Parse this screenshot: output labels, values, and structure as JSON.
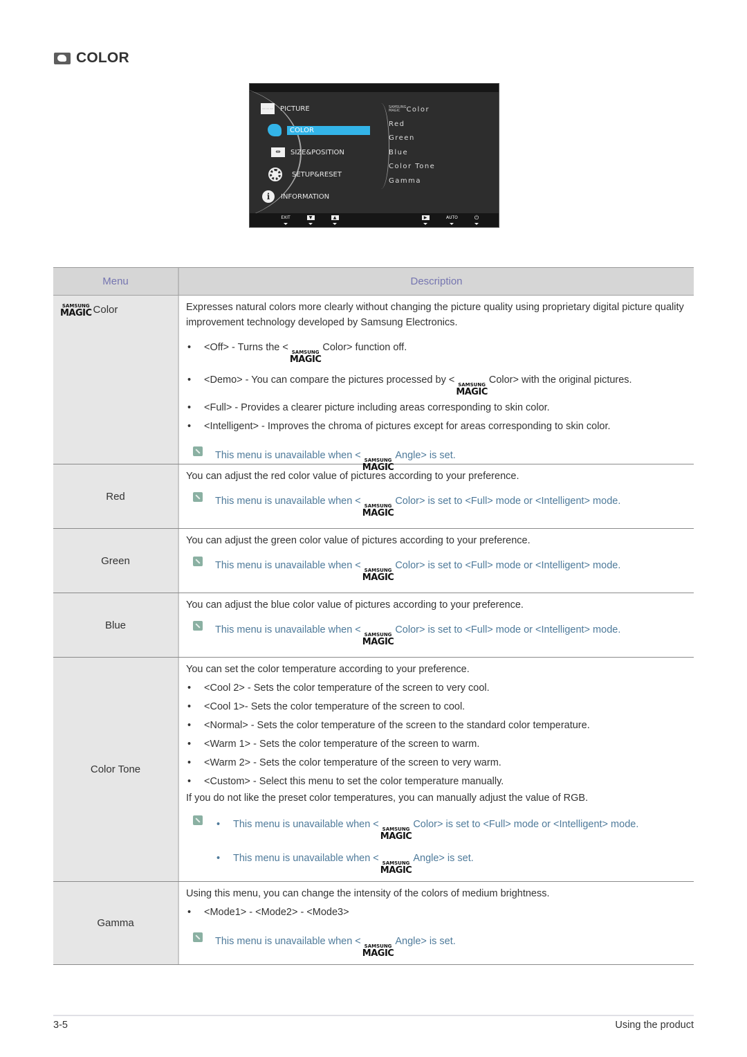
{
  "page": {
    "title": "COLOR",
    "title_icon": "palette-icon"
  },
  "osd": {
    "main_menu": [
      {
        "label": "PICTURE",
        "icon": "picture-icon"
      },
      {
        "label": "COLOR",
        "icon": "palette-icon",
        "selected": true
      },
      {
        "label": "SIZE&POSITION",
        "icon": "size-position-icon"
      },
      {
        "label": "SETUP&RESET",
        "icon": "gear-icon"
      },
      {
        "label": "INFORMATION",
        "icon": "info-icon"
      }
    ],
    "submenu": {
      "magic_top": "SAMSUNG",
      "magic_bottom": "MAGIC",
      "items": [
        "Color",
        "Red",
        "Green",
        "Blue",
        "Color Tone",
        "Gamma"
      ]
    },
    "buttons": {
      "exit": "EXIT",
      "down": "▼",
      "up": "▲",
      "enter": "▶",
      "auto": "AUTO",
      "power": "⏻"
    },
    "selected_color": "#33b4e8"
  },
  "magic": {
    "top": "SAMSUNG",
    "bottom": "MAGIC"
  },
  "table": {
    "headers": {
      "menu": "Menu",
      "description": "Description"
    },
    "header_color": "#7575b0",
    "note_color": "#4e7a9a",
    "rows": [
      {
        "menu": "Color",
        "intro": "Expresses natural colors more clearly without changing the picture quality using proprietary digital picture quality improvement technology developed by Samsung Electronics.",
        "bullets": [
          {
            "pre": "<Off> - Turns the <",
            "post": "Color> function off."
          },
          {
            "pre": "<Demo> - You can compare the pictures processed by <",
            "post": "Color> with the original pictures."
          },
          {
            "text": "<Full> - Provides a clearer picture including areas corresponding to skin color."
          },
          {
            "text": "<Intelligent> - Improves the chroma of pictures except for areas corresponding to skin color."
          }
        ],
        "note": {
          "pre": "This menu is unavailable when <",
          "post": "Angle> is set."
        }
      },
      {
        "menu": "Red",
        "intro": "You can adjust the red color value of pictures according to your preference.",
        "note": {
          "pre": "This menu is unavailable when <",
          "post": "Color> is set to <Full> mode or <Intelligent> mode."
        }
      },
      {
        "menu": "Green",
        "intro": "You can adjust the green color value of pictures according to your preference.",
        "note": {
          "pre": "This menu is unavailable when <",
          "post": "Color> is set to <Full> mode or <Intelligent> mode."
        }
      },
      {
        "menu": "Blue",
        "intro": "You can adjust the blue color value of pictures according to your preference.",
        "note": {
          "pre": "This menu is unavailable when <",
          "post": "Color> is set to <Full> mode or <Intelligent> mode."
        }
      },
      {
        "menu": "Color Tone",
        "intro": "You can set the color temperature according to your preference.",
        "bullets": [
          "<Cool 2> - Sets the color temperature of the screen to very cool.",
          "<Cool 1>- Sets the color temperature of the screen to cool.",
          "<Normal> - Sets the color temperature of the screen to the standard color temperature.",
          "<Warm 1> - Sets the color temperature of the screen to warm.",
          "<Warm 2> - Sets the color temperature of the screen to very warm.",
          "<Custom> - Select this menu to set the color temperature manually."
        ],
        "outro": "If you do not like the preset color temperatures, you can manually adjust the value of RGB.",
        "notes": [
          {
            "pre": "This menu is unavailable when <",
            "post": "Color> is set to <Full> mode or <Intelligent> mode."
          },
          {
            "pre": "This menu is unavailable when <",
            "post": "Angle> is set."
          }
        ]
      },
      {
        "menu": "Gamma",
        "intro": "Using this menu, you can change the intensity of the colors of medium brightness.",
        "bullets": [
          "<Mode1> - <Mode2> - <Mode3>"
        ],
        "note": {
          "pre": "This menu is unavailable when <",
          "post": "Angle> is set."
        }
      }
    ]
  },
  "footer": {
    "page_number": "3-5",
    "section": "Using the product"
  }
}
